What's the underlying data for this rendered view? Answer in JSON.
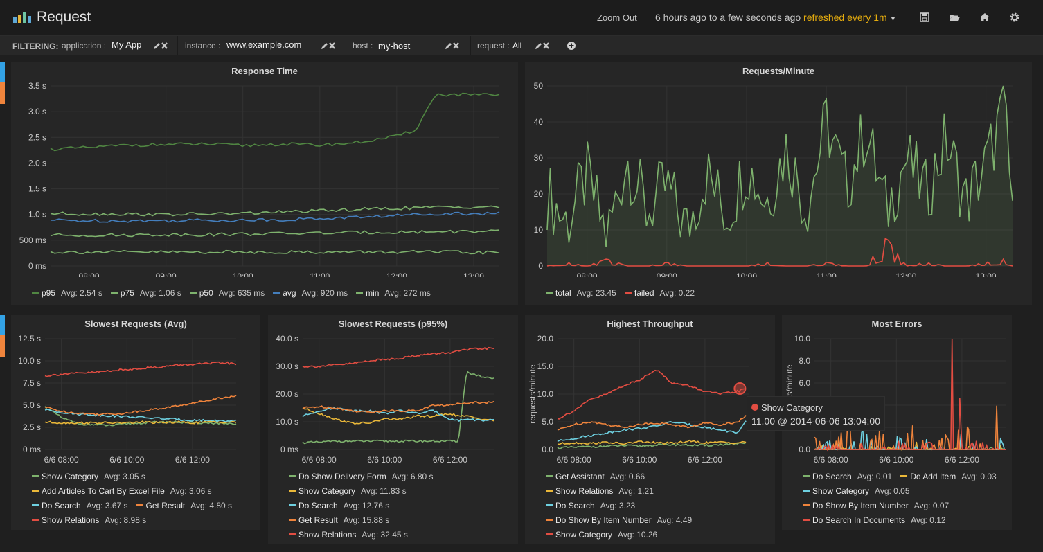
{
  "header": {
    "title": "Request",
    "zoom_out": "Zoom Out",
    "range_text": "6 hours ago to a few seconds ago",
    "refresh_text": "refreshed every 1m",
    "icons": [
      "save-icon",
      "folder-open-icon",
      "home-icon",
      "gear-icon"
    ]
  },
  "filters": {
    "label": "FILTERING:",
    "items": [
      {
        "key": "application :",
        "value": "My App"
      },
      {
        "key": "instance :",
        "value": "www.example.com"
      },
      {
        "key": "host :",
        "value": "my-host"
      },
      {
        "key": "request :",
        "value": "All"
      }
    ]
  },
  "colors": {
    "green": "#7eb26d",
    "darkgreen": "#508642",
    "blue": "#447ebc",
    "yellow": "#eab839",
    "cyan": "#6ed0e0",
    "orange": "#ef843c",
    "red": "#e24d42",
    "pink": "#e5a8e2"
  },
  "panels": [
    {
      "title": "Response Time",
      "chart_data": {
        "type": "line",
        "x_ticks": [
          "08:00",
          "09:00",
          "10:00",
          "11:00",
          "12:00",
          "13:00"
        ],
        "y_ticks": [
          "0 ms",
          "500 ms",
          "1.0 s",
          "1.5 s",
          "2.0 s",
          "2.5 s",
          "3.0 s",
          "3.5 s"
        ],
        "ylim": [
          0,
          3.5
        ],
        "x": [
          "07:30",
          "08:00",
          "08:30",
          "09:00",
          "09:30",
          "10:00",
          "10:30",
          "11:00",
          "11:30",
          "12:00",
          "12:15",
          "12:30",
          "13:00",
          "13:20"
        ],
        "series": [
          {
            "name": "p95",
            "avg": "Avg: 2.54 s",
            "color": "#508642",
            "values": [
              2.27,
              2.3,
              2.35,
              2.36,
              2.37,
              2.34,
              2.37,
              2.35,
              2.4,
              2.52,
              2.65,
              3.33,
              3.33,
              3.31
            ]
          },
          {
            "name": "p75",
            "avg": "Avg: 1.06 s",
            "color": "#7eb26d",
            "values": [
              1.02,
              1.01,
              1.01,
              1.0,
              1.01,
              1.02,
              1.05,
              1.07,
              1.1,
              1.12,
              1.13,
              1.14,
              1.15,
              1.15
            ]
          },
          {
            "name": "p50",
            "avg": "Avg: 635 ms",
            "color": "#7eb26d",
            "values": [
              0.6,
              0.6,
              0.6,
              0.61,
              0.61,
              0.62,
              0.63,
              0.64,
              0.65,
              0.66,
              0.66,
              0.67,
              0.67,
              0.67
            ]
          },
          {
            "name": "avg",
            "avg": "Avg: 920 ms",
            "color": "#447ebc",
            "values": [
              0.89,
              0.88,
              0.88,
              0.88,
              0.89,
              0.89,
              0.9,
              0.92,
              0.95,
              0.98,
              1.0,
              1.02,
              1.02,
              1.02
            ]
          },
          {
            "name": "min",
            "avg": "Avg: 272 ms",
            "color": "#7eb26d",
            "values": [
              0.27,
              0.27,
              0.27,
              0.27,
              0.27,
              0.27,
              0.27,
              0.27,
              0.27,
              0.27,
              0.27,
              0.27,
              0.26,
              0.26
            ]
          }
        ]
      }
    },
    {
      "title": "Requests/Minute",
      "chart_data": {
        "type": "area",
        "x_ticks": [
          "08:00",
          "09:00",
          "10:00",
          "11:00",
          "12:00",
          "13:00"
        ],
        "y_ticks": [
          "0",
          "10",
          "20",
          "30",
          "40",
          "50"
        ],
        "ylim": [
          0,
          50
        ],
        "x": [
          "07:30",
          "07:45",
          "08:00",
          "08:15",
          "08:30",
          "08:45",
          "09:00",
          "09:15",
          "09:30",
          "09:45",
          "10:00",
          "10:15",
          "10:30",
          "10:45",
          "11:00",
          "11:15",
          "11:30",
          "11:45",
          "12:00",
          "12:15",
          "12:30",
          "12:45",
          "13:00",
          "13:15",
          "13:20"
        ],
        "series": [
          {
            "name": "total",
            "avg": "Avg: 23.45",
            "color": "#7eb26d",
            "fill": true,
            "values": [
              20,
              12,
              25,
              8,
              30,
              15,
              22,
              10,
              26,
              14,
              28,
              18,
              33,
              16,
              40,
              22,
              38,
              15,
              30,
              20,
              35,
              18,
              28,
              45,
              10
            ]
          },
          {
            "name": "failed",
            "avg": "Avg: 0.22",
            "color": "#e24d42",
            "values": [
              0,
              1,
              0,
              2,
              0,
              0,
              1,
              0,
              0,
              0,
              0,
              1,
              0,
              0,
              1,
              0,
              0,
              8,
              0,
              1,
              0,
              0,
              1,
              2,
              0
            ]
          }
        ]
      }
    },
    {
      "title": "Slowest Requests (Avg)",
      "chart_data": {
        "type": "line",
        "x_ticks": [
          "6/6 08:00",
          "6/6 10:00",
          "6/6 12:00"
        ],
        "y_ticks": [
          "0 ms",
          "2.5 s",
          "5.0 s",
          "7.5 s",
          "10.0 s",
          "12.5 s"
        ],
        "ylim": [
          0,
          12.5
        ],
        "x": [
          "07:30",
          "08:00",
          "08:30",
          "09:00",
          "09:30",
          "10:00",
          "10:30",
          "11:00",
          "11:30",
          "12:00",
          "12:30",
          "13:00",
          "13:20"
        ],
        "series": [
          {
            "name": "Show Category",
            "avg": "Avg: 3.05 s",
            "color": "#7eb26d",
            "values": [
              4.8,
              3.6,
              2.9,
              2.8,
              2.7,
              2.9,
              3.0,
              3.1,
              3.1,
              3.0,
              3.0,
              2.9,
              2.8
            ]
          },
          {
            "name": "Add Articles To Cart By Excel File",
            "avg": "Avg: 3.06 s",
            "color": "#eab839",
            "values": [
              3.1,
              3.0,
              3.0,
              3.0,
              3.0,
              3.0,
              3.1,
              3.0,
              3.1,
              3.0,
              3.1,
              3.1,
              3.1
            ]
          },
          {
            "name": "Do Search",
            "avg": "Avg: 3.67 s",
            "color": "#6ed0e0",
            "values": [
              4.5,
              4.2,
              4.0,
              3.9,
              3.8,
              3.7,
              3.6,
              3.5,
              3.4,
              3.3,
              3.3,
              3.2,
              3.2
            ]
          },
          {
            "name": "Get Result",
            "avg": "Avg: 4.80 s",
            "color": "#ef843c",
            "values": [
              4.8,
              4.3,
              4.1,
              4.0,
              4.0,
              4.1,
              4.4,
              4.6,
              4.9,
              5.2,
              5.6,
              5.9,
              6.0
            ]
          },
          {
            "name": "Show Relations",
            "avg": "Avg: 8.98 s",
            "color": "#e24d42",
            "values": [
              8.3,
              8.5,
              8.6,
              8.7,
              8.9,
              9.0,
              9.2,
              9.3,
              9.5,
              9.6,
              9.7,
              9.8,
              9.6
            ]
          }
        ]
      }
    },
    {
      "title": "Slowest Requests (p95%)",
      "chart_data": {
        "type": "line",
        "x_ticks": [
          "6/6 08:00",
          "6/6 10:00",
          "6/6 12:00"
        ],
        "y_ticks": [
          "0 ms",
          "10.0 s",
          "20.0 s",
          "30.0 s",
          "40.0 s"
        ],
        "ylim": [
          0,
          40
        ],
        "x": [
          "07:30",
          "08:00",
          "08:30",
          "09:00",
          "09:30",
          "10:00",
          "10:30",
          "11:00",
          "11:30",
          "12:00",
          "12:15",
          "12:30",
          "13:00",
          "13:20"
        ],
        "series": [
          {
            "name": "Do Show Delivery Form",
            "avg": "Avg: 6.80 s",
            "color": "#7eb26d",
            "values": [
              2.5,
              2.6,
              3.0,
              3.0,
              3.0,
              3.0,
              3.0,
              3.0,
              3.0,
              3.0,
              3.0,
              28,
              26,
              25.5
            ]
          },
          {
            "name": "Show Category",
            "avg": "Avg: 11.83 s",
            "color": "#eab839",
            "values": [
              15,
              13,
              11,
              9.5,
              9.5,
              11,
              11,
              12,
              12,
              13,
              12,
              12,
              11,
              10.5
            ]
          },
          {
            "name": "Do Search",
            "avg": "Avg: 12.76 s",
            "color": "#6ed0e0",
            "values": [
              12,
              14,
              15,
              14,
              14,
              13,
              14,
              13,
              14,
              11,
              10.5,
              11,
              10.5,
              10.5
            ]
          },
          {
            "name": "Get Result",
            "avg": "Avg: 15.88 s",
            "color": "#ef843c",
            "values": [
              15,
              15.5,
              15,
              14,
              13.5,
              14,
              14,
              14,
              16,
              16,
              16.5,
              17,
              17,
              17
            ]
          },
          {
            "name": "Show Relations",
            "avg": "Avg: 32.45 s",
            "color": "#e24d42",
            "values": [
              30,
              30,
              30.5,
              31,
              32,
              32.5,
              33,
              34,
              34.5,
              35,
              35.5,
              36,
              36.5,
              36.5
            ]
          }
        ]
      }
    },
    {
      "title": "Highest Throughput",
      "chart_data": {
        "type": "line",
        "ylabel": "requests/minute",
        "x_ticks": [
          "6/6 08:00",
          "6/6 10:00",
          "6/6 12:00"
        ],
        "y_ticks": [
          "0.0",
          "5.0",
          "10.0",
          "15.0",
          "20.0"
        ],
        "ylim": [
          0,
          20
        ],
        "x": [
          "07:30",
          "08:00",
          "08:30",
          "09:00",
          "09:30",
          "10:00",
          "10:30",
          "11:00",
          "11:30",
          "12:00",
          "12:30",
          "13:00",
          "13:15"
        ],
        "series": [
          {
            "name": "Get Assistant",
            "avg": "Avg: 0.66",
            "color": "#7eb26d",
            "values": [
              0.3,
              0.4,
              0.5,
              0.6,
              0.7,
              0.6,
              0.8,
              0.9,
              0.8,
              0.7,
              0.9,
              1.0,
              1.1
            ]
          },
          {
            "name": "Show Relations",
            "avg": "Avg: 1.21",
            "color": "#eab839",
            "values": [
              1.0,
              1.2,
              1.1,
              1.3,
              1.0,
              1.4,
              1.2,
              1.1,
              1.5,
              1.2,
              1.3,
              1.2,
              1.4
            ]
          },
          {
            "name": "Do Search",
            "avg": "Avg: 3.23",
            "color": "#6ed0e0",
            "values": [
              1.5,
              2.0,
              2.5,
              3.0,
              3.5,
              3.8,
              4.2,
              5.0,
              4.5,
              4.0,
              3.5,
              3.0,
              5.0
            ]
          },
          {
            "name": "Do Show By Item Number",
            "avg": "Avg: 4.49",
            "color": "#ef843c",
            "values": [
              3.5,
              4.5,
              5.0,
              4.5,
              4.0,
              4.5,
              4.8,
              4.5,
              4.0,
              4.8,
              4.5,
              5.0,
              6.0
            ]
          },
          {
            "name": "Show Category",
            "avg": "Avg: 10.26",
            "color": "#e24d42",
            "values": [
              5.5,
              7.0,
              9.0,
              10.0,
              11.5,
              12.5,
              14.5,
              12.0,
              11.5,
              10.5,
              10.0,
              10.5,
              11.0
            ]
          }
        ]
      },
      "tooltip": {
        "series": "Show Category",
        "value": "11.00 @ 2014-06-06 13:04:00"
      }
    },
    {
      "title": "Most Errors",
      "chart_data": {
        "type": "line",
        "ylabel": "requests/minute",
        "x_ticks": [
          "6/6 08:00",
          "6/6 10:00",
          "6/6 12:00"
        ],
        "y_ticks": [
          "0.0",
          "2.0",
          "4.0",
          "6.0",
          "8.0",
          "10.0"
        ],
        "ylim": [
          0,
          10
        ],
        "x": [
          "07:30",
          "08:00",
          "08:30",
          "09:00",
          "09:30",
          "10:00",
          "10:30",
          "11:00",
          "11:30",
          "11:45",
          "12:00",
          "12:30",
          "13:00",
          "13:20"
        ],
        "series": [
          {
            "name": "Do Search",
            "avg": "Avg: 0.01",
            "color": "#7eb26d",
            "values": [
              0,
              0,
              0,
              0,
              0.1,
              0,
              0,
              0,
              0,
              0,
              0,
              0,
              0.1,
              0
            ]
          },
          {
            "name": "Do Add Item",
            "avg": "Avg: 0.03",
            "color": "#eab839",
            "values": [
              0,
              0.3,
              0,
              0,
              0.2,
              0,
              0.4,
              0,
              0,
              0,
              0.2,
              0,
              0.3,
              0
            ]
          },
          {
            "name": "Show Category",
            "avg": "Avg: 0.05",
            "color": "#6ed0e0",
            "values": [
              0,
              0.4,
              0,
              0.8,
              0,
              0.6,
              0,
              0.5,
              0,
              0,
              0.7,
              0,
              0.9,
              0
            ]
          },
          {
            "name": "Do Show By Item Number",
            "avg": "Avg: 0.07",
            "color": "#ef843c",
            "values": [
              0.5,
              0,
              1.1,
              0,
              0.8,
              0,
              1.0,
              0,
              0.6,
              0,
              1.4,
              0,
              2.2,
              0
            ]
          },
          {
            "name": "Do Search In Documents",
            "avg": "Avg: 0.12",
            "color": "#e24d42",
            "values": [
              0,
              0.2,
              0,
              0.3,
              0,
              0.4,
              0,
              0.3,
              0,
              7.9,
              0,
              0.4,
              0,
              0.2
            ]
          }
        ]
      }
    }
  ]
}
